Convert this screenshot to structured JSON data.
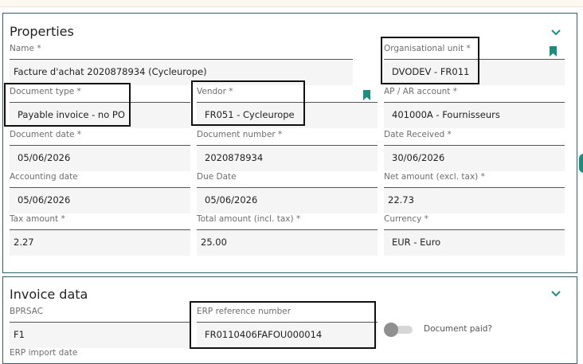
{
  "properties": {
    "title": "Properties",
    "fields": {
      "name": {
        "label": "Name *",
        "value": "Facture d'achat 2020878934 (Cycleurope)"
      },
      "org_unit": {
        "label": "Organisational unit *",
        "value": "DVODEV - FR011"
      },
      "doc_type": {
        "label": "Document type *",
        "value": "Payable invoice - no PO"
      },
      "vendor": {
        "label": "Vendor *",
        "value": "FR051 - Cycleurope"
      },
      "ap_account": {
        "label": "AP / AR account *",
        "value": "401000A - Fournisseurs"
      },
      "doc_date": {
        "label": "Document date *",
        "value": "05/06/2026"
      },
      "doc_number": {
        "label": "Document number *",
        "value": "2020878934"
      },
      "date_received": {
        "label": "Date Received *",
        "value": "30/06/2026"
      },
      "accounting_date": {
        "label": "Accounting date",
        "value": "05/06/2026"
      },
      "due_date": {
        "label": "Due Date",
        "value": "05/06/2026"
      },
      "net_amount": {
        "label": "Net amount (excl. tax) *",
        "value": "22.73"
      },
      "tax_amount": {
        "label": "Tax amount *",
        "value": "2.27"
      },
      "total_amount": {
        "label": "Total amount (incl. tax) *",
        "value": "25.00"
      },
      "currency": {
        "label": "Currency *",
        "value": "EUR - Euro"
      }
    }
  },
  "invoice_data": {
    "title": "Invoice data",
    "fields": {
      "bprsac": {
        "label": "BPRSAC",
        "value": "F1"
      },
      "erp_ref": {
        "label": "ERP reference number",
        "value": "FR0110406FAFOU000014"
      },
      "erp_import_date": {
        "label": "ERP import date"
      }
    },
    "document_paid": {
      "label": "Document paid?",
      "checked": false
    }
  },
  "colors": {
    "accent": "#1a8f7f",
    "panel_border": "#2f5f6a"
  },
  "icons": {
    "collapse": "chevron-down-icon",
    "bookmark": "bookmark-icon"
  }
}
